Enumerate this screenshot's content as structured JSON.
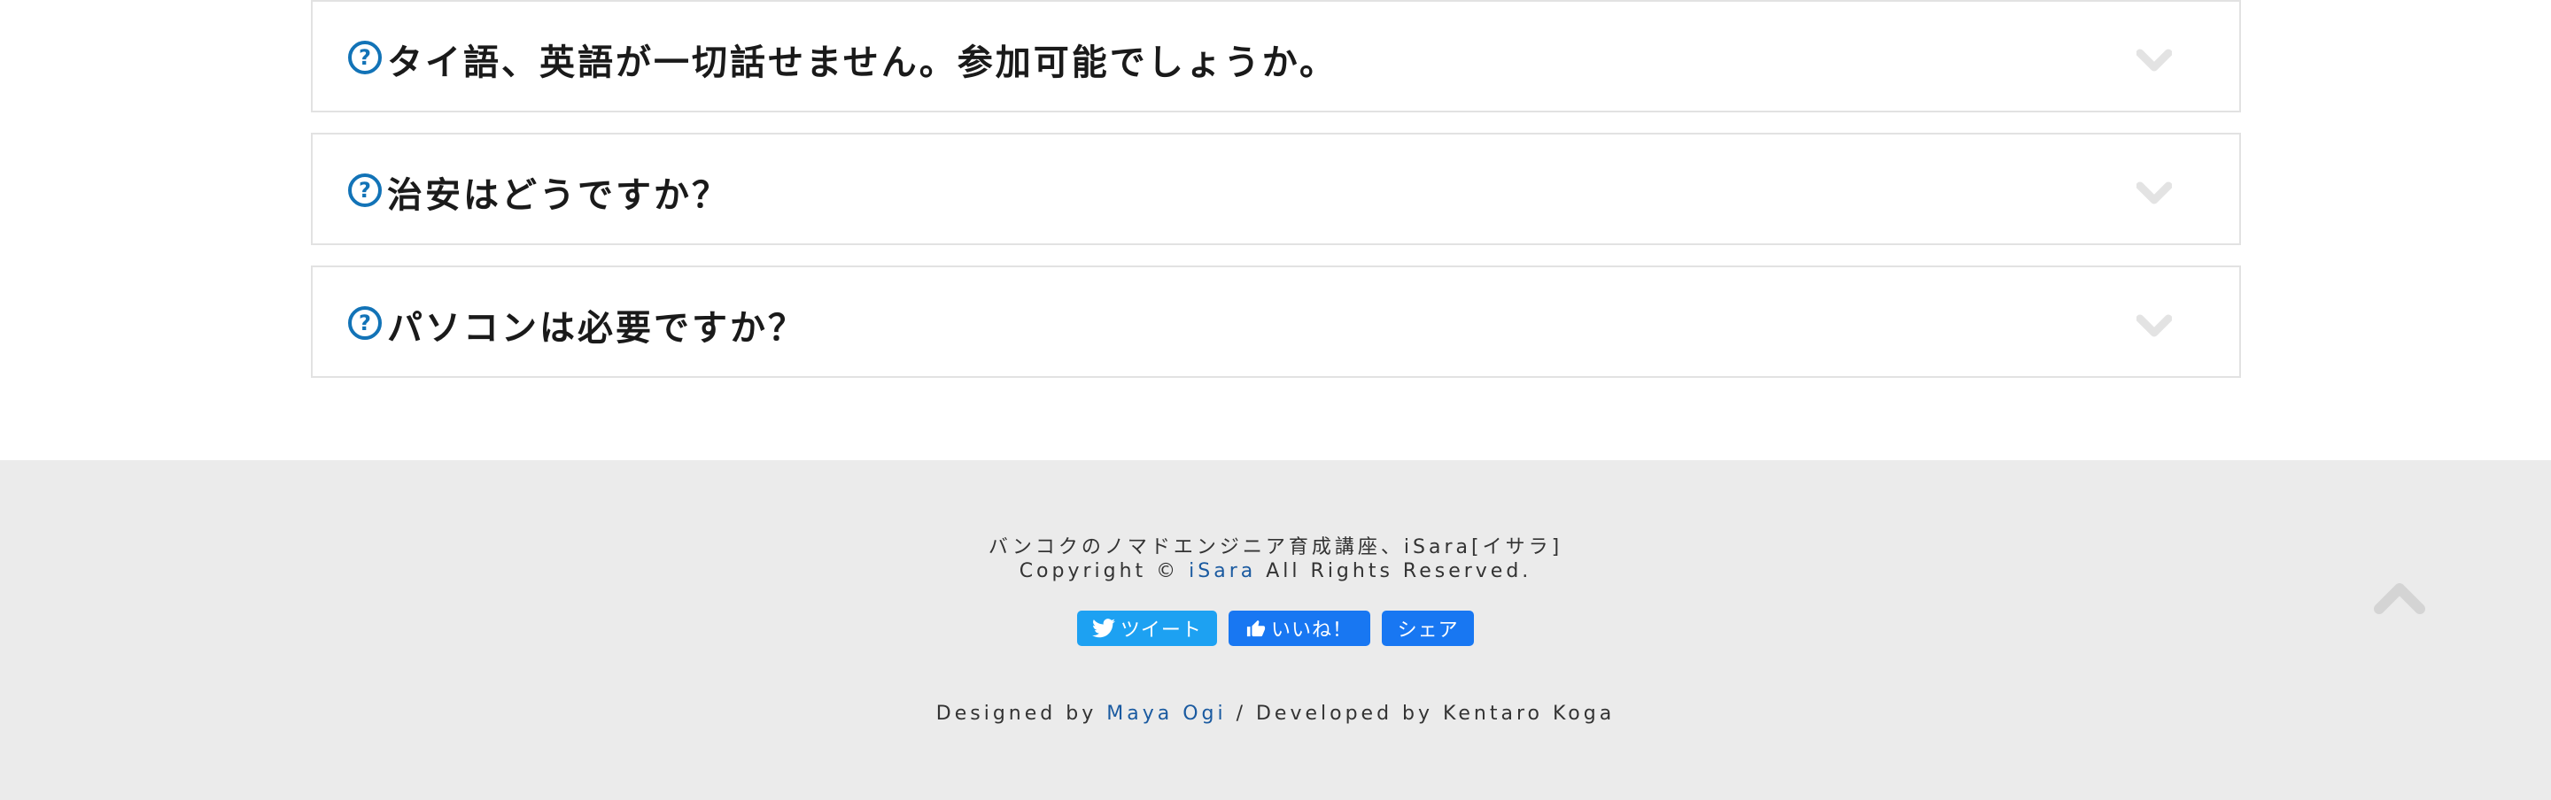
{
  "faq": [
    {
      "question": "タイ語、英語が一切話せません。参加可能でしょうか。"
    },
    {
      "question": "治安はどうですか？"
    },
    {
      "question": "パソコンは必要ですか？"
    }
  ],
  "question_mark": "?",
  "footer": {
    "tagline": "バンコクのノマドエンジニア育成講座、iSara[イサラ]",
    "copyright_prefix": "Copyright © ",
    "copyright_link": "iSara",
    "copyright_suffix": " All Rights Reserved.",
    "designed_prefix": "Designed by ",
    "designer": "Maya Ogi",
    "developed": " / Developed by Kentaro Koga"
  },
  "social": {
    "tweet": "ツイート",
    "like": "いいね！",
    "share": "シェア"
  },
  "colors": {
    "accent": "#1273b7",
    "footer_bg": "#ebebeb",
    "twitter": "#1da1f2",
    "facebook": "#1877f2"
  },
  "icons": [
    "question-circle-icon",
    "chevron-down-icon",
    "twitter-bird-icon",
    "thumbs-up-icon",
    "chevron-up-icon"
  ]
}
